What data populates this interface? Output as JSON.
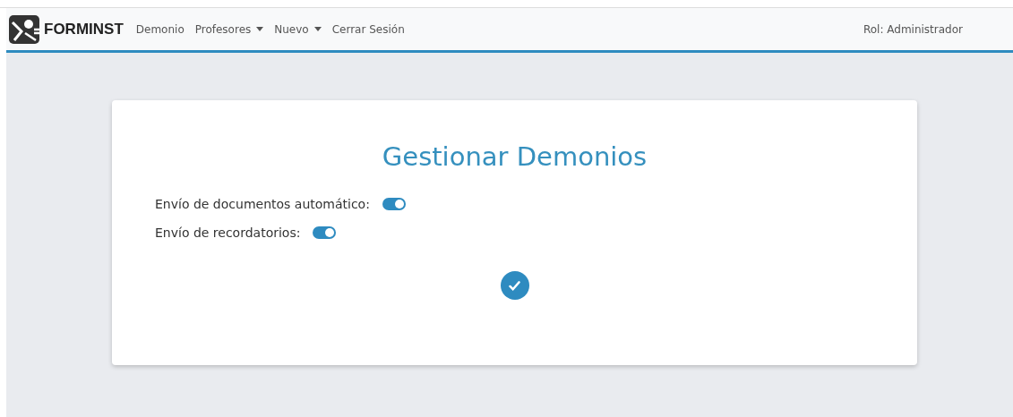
{
  "navbar": {
    "brand": "FORMINST",
    "items": [
      {
        "label": "Demonio",
        "dropdown": false
      },
      {
        "label": "Profesores",
        "dropdown": true
      },
      {
        "label": "Nuevo",
        "dropdown": true
      },
      {
        "label": "Cerrar Sesión",
        "dropdown": false
      }
    ],
    "role": "Rol: Administrador"
  },
  "card": {
    "title": "Gestionar Demonios",
    "switches": [
      {
        "label": "Envío de documentos automático:",
        "on": true
      },
      {
        "label": "Envío de recordatorios:",
        "on": true
      }
    ]
  }
}
